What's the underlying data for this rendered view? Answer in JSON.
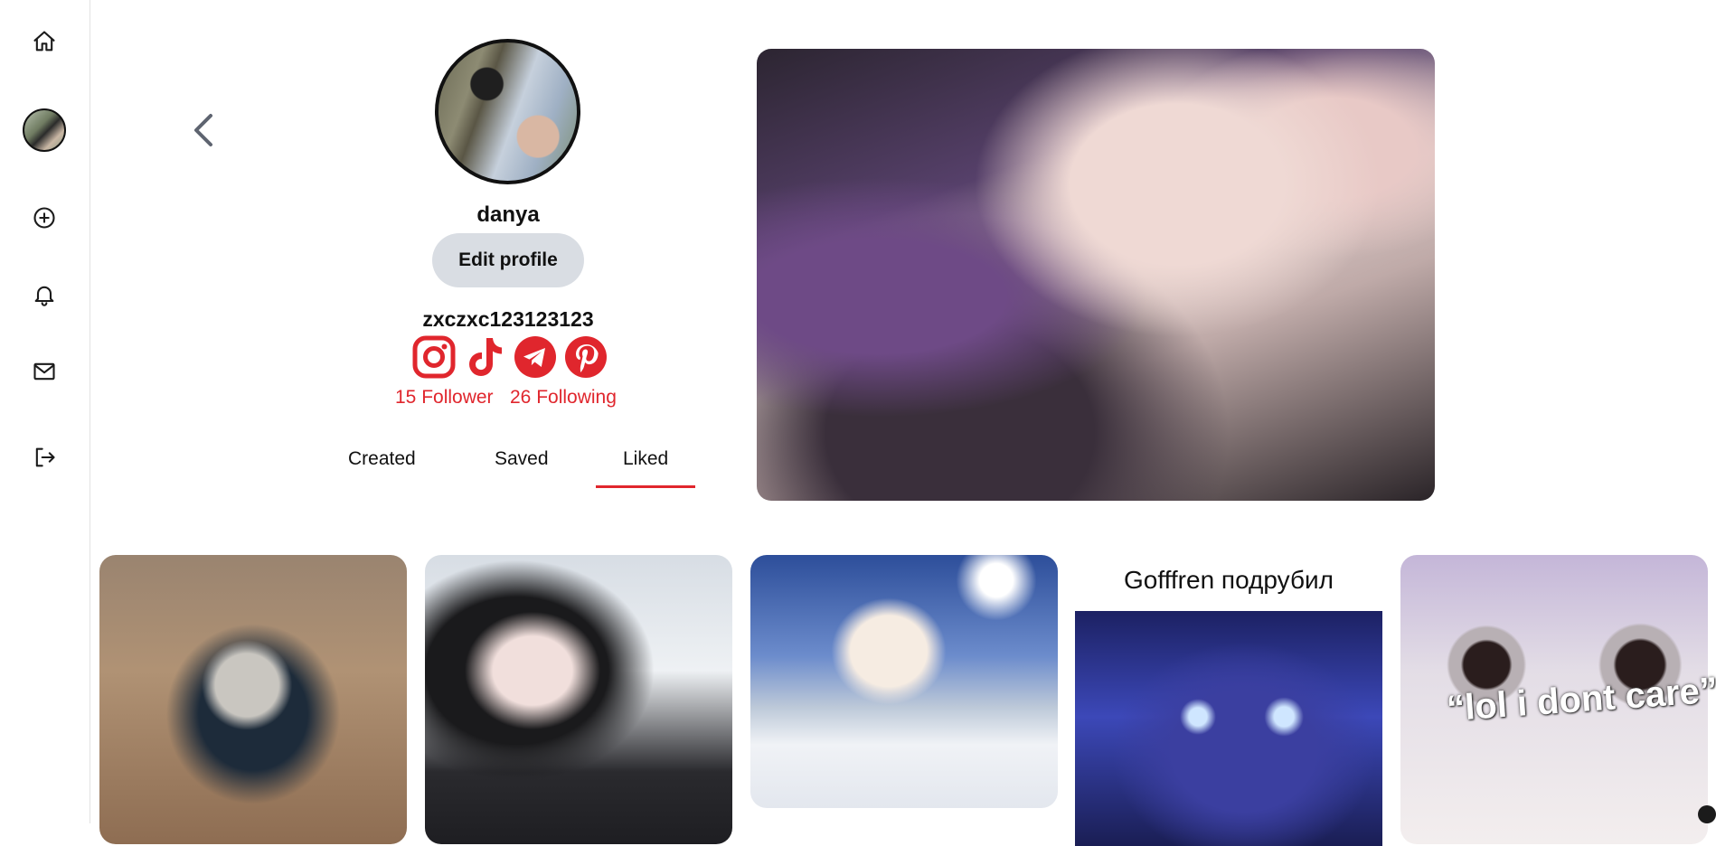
{
  "sidebar": {
    "items": [
      {
        "name": "home",
        "icon": "home-icon"
      },
      {
        "name": "profile",
        "icon": "avatar"
      },
      {
        "name": "create",
        "icon": "plus-circle-icon"
      },
      {
        "name": "notifications",
        "icon": "bell-icon"
      },
      {
        "name": "messages",
        "icon": "mail-icon"
      },
      {
        "name": "logout",
        "icon": "logout-icon"
      }
    ]
  },
  "profile": {
    "username": "danya",
    "edit_label": "Edit profile",
    "handle": "zxczxc123123123",
    "followers": "15 Follower",
    "following": "26 Following",
    "socials": [
      "instagram-icon",
      "tiktok-icon",
      "telegram-icon",
      "pinterest-icon"
    ]
  },
  "tabs": {
    "created": "Created",
    "saved": "Saved",
    "liked": "Liked",
    "active": "Liked"
  },
  "feed": {
    "card4_caption": "Gofffren подрубил",
    "card5_text": "“lol i dont care”"
  },
  "colors": {
    "accent": "#e0262d",
    "button_bg": "#d9dde3"
  }
}
